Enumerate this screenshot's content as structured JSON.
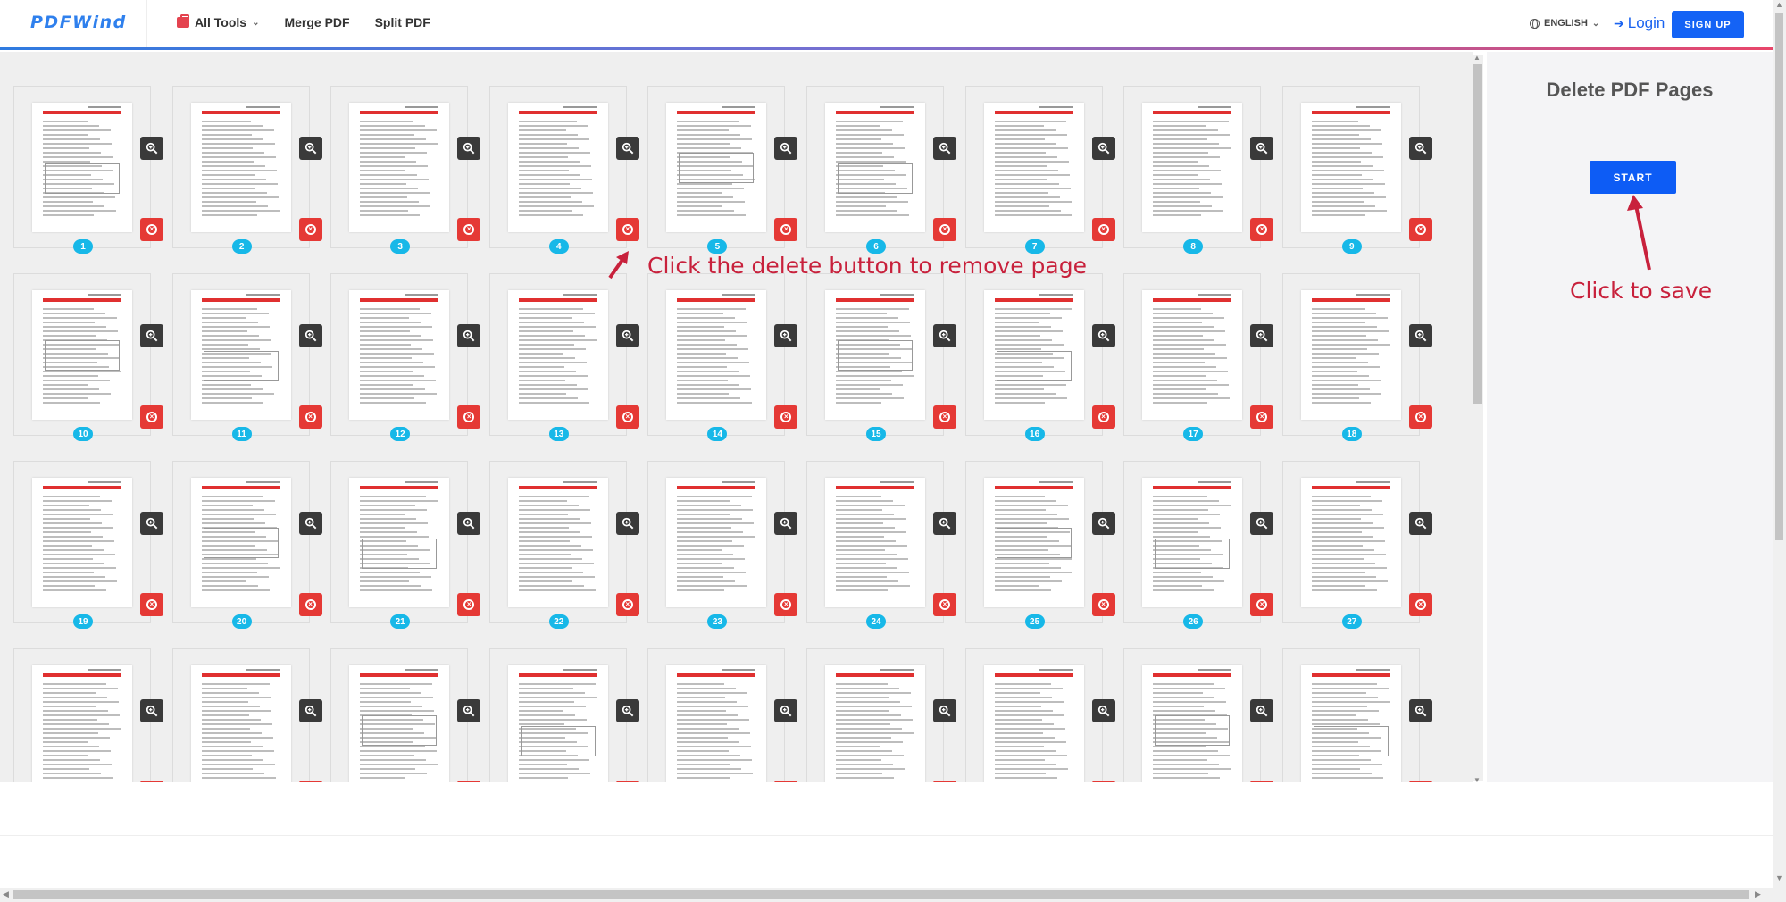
{
  "header": {
    "logo": "PDFWind",
    "nav": [
      {
        "label": "All Tools",
        "has_dropdown": true,
        "icon": "toolbox-icon"
      },
      {
        "label": "Merge PDF"
      },
      {
        "label": "Split PDF"
      }
    ],
    "language": "ENGLISH",
    "login": "Login",
    "signup": "SIGN UP"
  },
  "pages": [
    "1",
    "2",
    "3",
    "4",
    "5",
    "6",
    "7",
    "8",
    "9",
    "10",
    "11",
    "12",
    "13",
    "14",
    "15",
    "16",
    "17",
    "18",
    "19",
    "20",
    "21",
    "22",
    "23",
    "24",
    "25",
    "26",
    "27",
    "",
    "",
    "",
    "",
    "",
    "",
    "",
    "",
    ""
  ],
  "side_panel": {
    "title": "Delete PDF Pages",
    "start_label": "START"
  },
  "annotations": {
    "delete_hint": "Click the delete button to remove page",
    "save_hint": "Click to save"
  },
  "colors": {
    "accent": "#0d5cf5",
    "delete": "#e53935",
    "badge": "#17b8e8",
    "annotation": "#c8213c"
  }
}
